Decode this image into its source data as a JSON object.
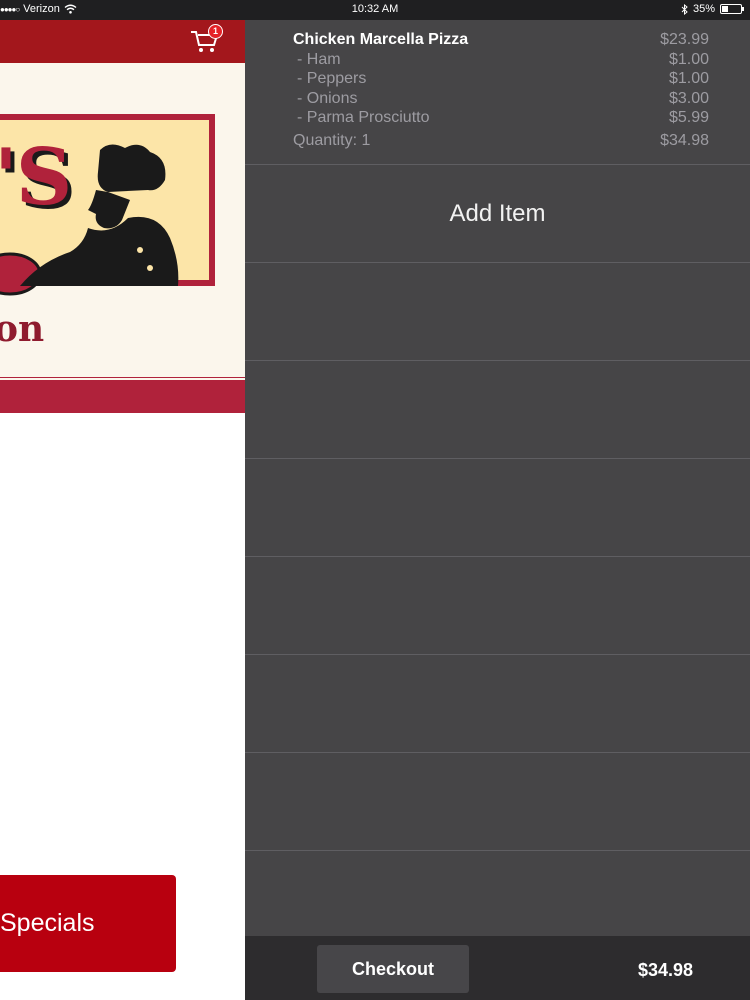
{
  "status_bar": {
    "carrier": "Verizon",
    "time": "10:32 AM",
    "battery": "35%",
    "battery_level": 0.35
  },
  "left_app": {
    "cart_badge": "1",
    "logo_letters": "'S",
    "logo_word": "on",
    "specials_label": "Specials",
    "brand_color": "#a3171c"
  },
  "order": {
    "item_name": "Chicken Marcella Pizza",
    "item_price": "$23.99",
    "toppings": [
      {
        "label": "- Ham",
        "price": "$1.00"
      },
      {
        "label": "- Peppers",
        "price": "$1.00"
      },
      {
        "label": "- Onions",
        "price": "$3.00"
      },
      {
        "label": "- Parma Prosciutto",
        "price": "$5.99"
      }
    ],
    "quantity_label": "Quantity: 1",
    "line_total": "$34.98"
  },
  "add_item_label": "Add Item",
  "checkout": {
    "label": "Checkout",
    "total": "$34.98"
  }
}
